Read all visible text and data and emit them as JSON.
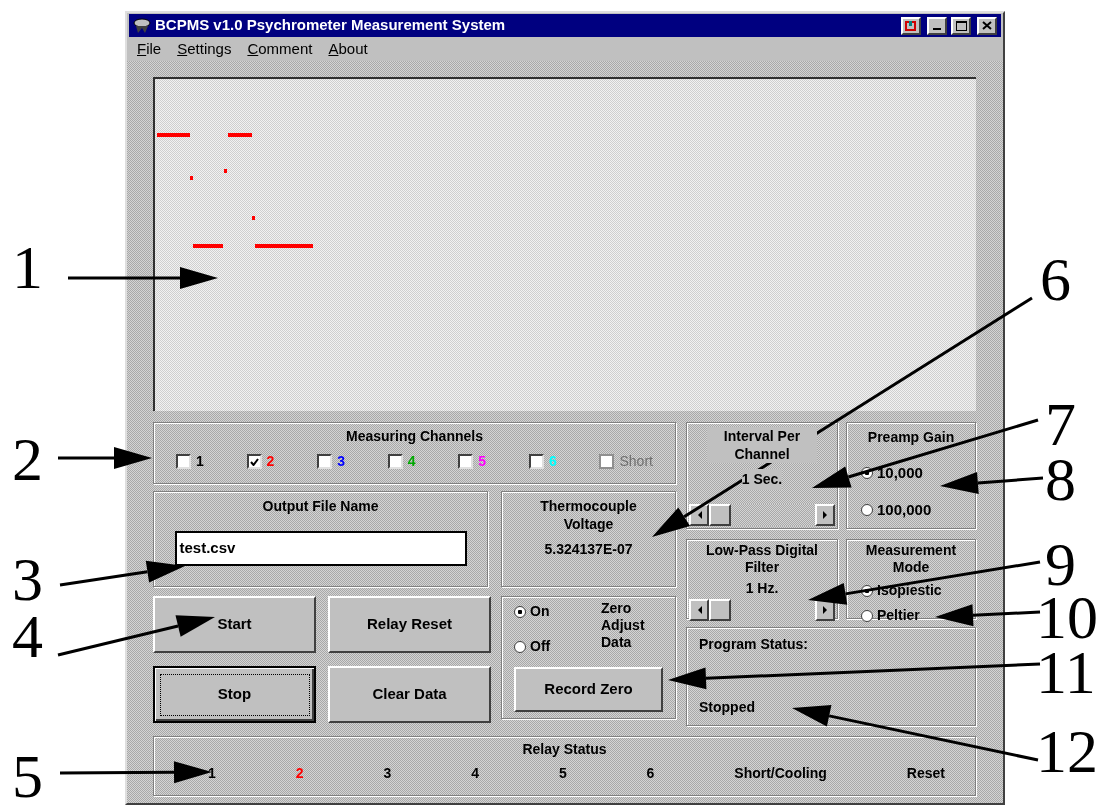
{
  "window": {
    "title": "BCPMS v1.0 Psychrometer Measurement System"
  },
  "menu": [
    "File",
    "Settings",
    "Comment",
    "About"
  ],
  "channels": {
    "title": "Measuring Channels",
    "items": [
      {
        "label": "1",
        "checked": false,
        "disabled": false,
        "color": "#000000"
      },
      {
        "label": "2",
        "checked": true,
        "disabled": false,
        "color": "#ff0000"
      },
      {
        "label": "3",
        "checked": false,
        "disabled": false,
        "color": "#0000ff"
      },
      {
        "label": "4",
        "checked": false,
        "disabled": false,
        "color": "#00a800"
      },
      {
        "label": "5",
        "checked": false,
        "disabled": false,
        "color": "#ff00ff"
      },
      {
        "label": "6",
        "checked": false,
        "disabled": false,
        "color": "#00ffff"
      },
      {
        "label": "Short",
        "checked": false,
        "disabled": true,
        "color": "#707070"
      }
    ]
  },
  "output_file": {
    "title": "Output File Name",
    "value": "test.csv"
  },
  "thermocouple": {
    "title": "Thermocouple Voltage",
    "value": "5.324137E-07"
  },
  "interval": {
    "title": "Interval Per Channel",
    "reading": "1 Sec."
  },
  "preamp_gain": {
    "title": "Preamp Gain",
    "options": [
      {
        "label": "10,000",
        "selected": true
      },
      {
        "label": "100,000",
        "selected": false
      }
    ]
  },
  "low_pass": {
    "title": "Low-Pass Digital Filter",
    "reading": "1 Hz."
  },
  "measurement_mode": {
    "title": "Measurement Mode",
    "options": [
      {
        "label": "Isopiestic",
        "selected": true
      },
      {
        "label": "Peltier",
        "selected": false
      }
    ]
  },
  "buttons": [
    {
      "label": "Start",
      "focused": false
    },
    {
      "label": "Relay Reset",
      "focused": false
    },
    {
      "label": "Stop",
      "focused": true
    },
    {
      "label": "Clear Data",
      "focused": false
    }
  ],
  "zero_adjust": {
    "options": [
      {
        "label": "On",
        "selected": true
      },
      {
        "label": "Off",
        "selected": false
      }
    ],
    "label": "Zero Adjust Data",
    "button": "Record Zero"
  },
  "program_status": {
    "title": "Program Status:",
    "value": "Stopped"
  },
  "relay_status": {
    "title": "Relay Status",
    "items": [
      {
        "label": "1",
        "color": "#000000"
      },
      {
        "label": "2",
        "color": "#ff0000"
      },
      {
        "label": "3",
        "color": "#000000"
      },
      {
        "label": "4",
        "color": "#000000"
      },
      {
        "label": "5",
        "color": "#000000"
      },
      {
        "label": "6",
        "color": "#000000"
      },
      {
        "label": "Short/Cooling",
        "color": "#000000"
      },
      {
        "label": "Reset",
        "color": "#000000"
      }
    ]
  },
  "callouts": [
    "1",
    "2",
    "3",
    "4",
    "5",
    "6",
    "7",
    "8",
    "9",
    "10",
    "11",
    "12"
  ]
}
